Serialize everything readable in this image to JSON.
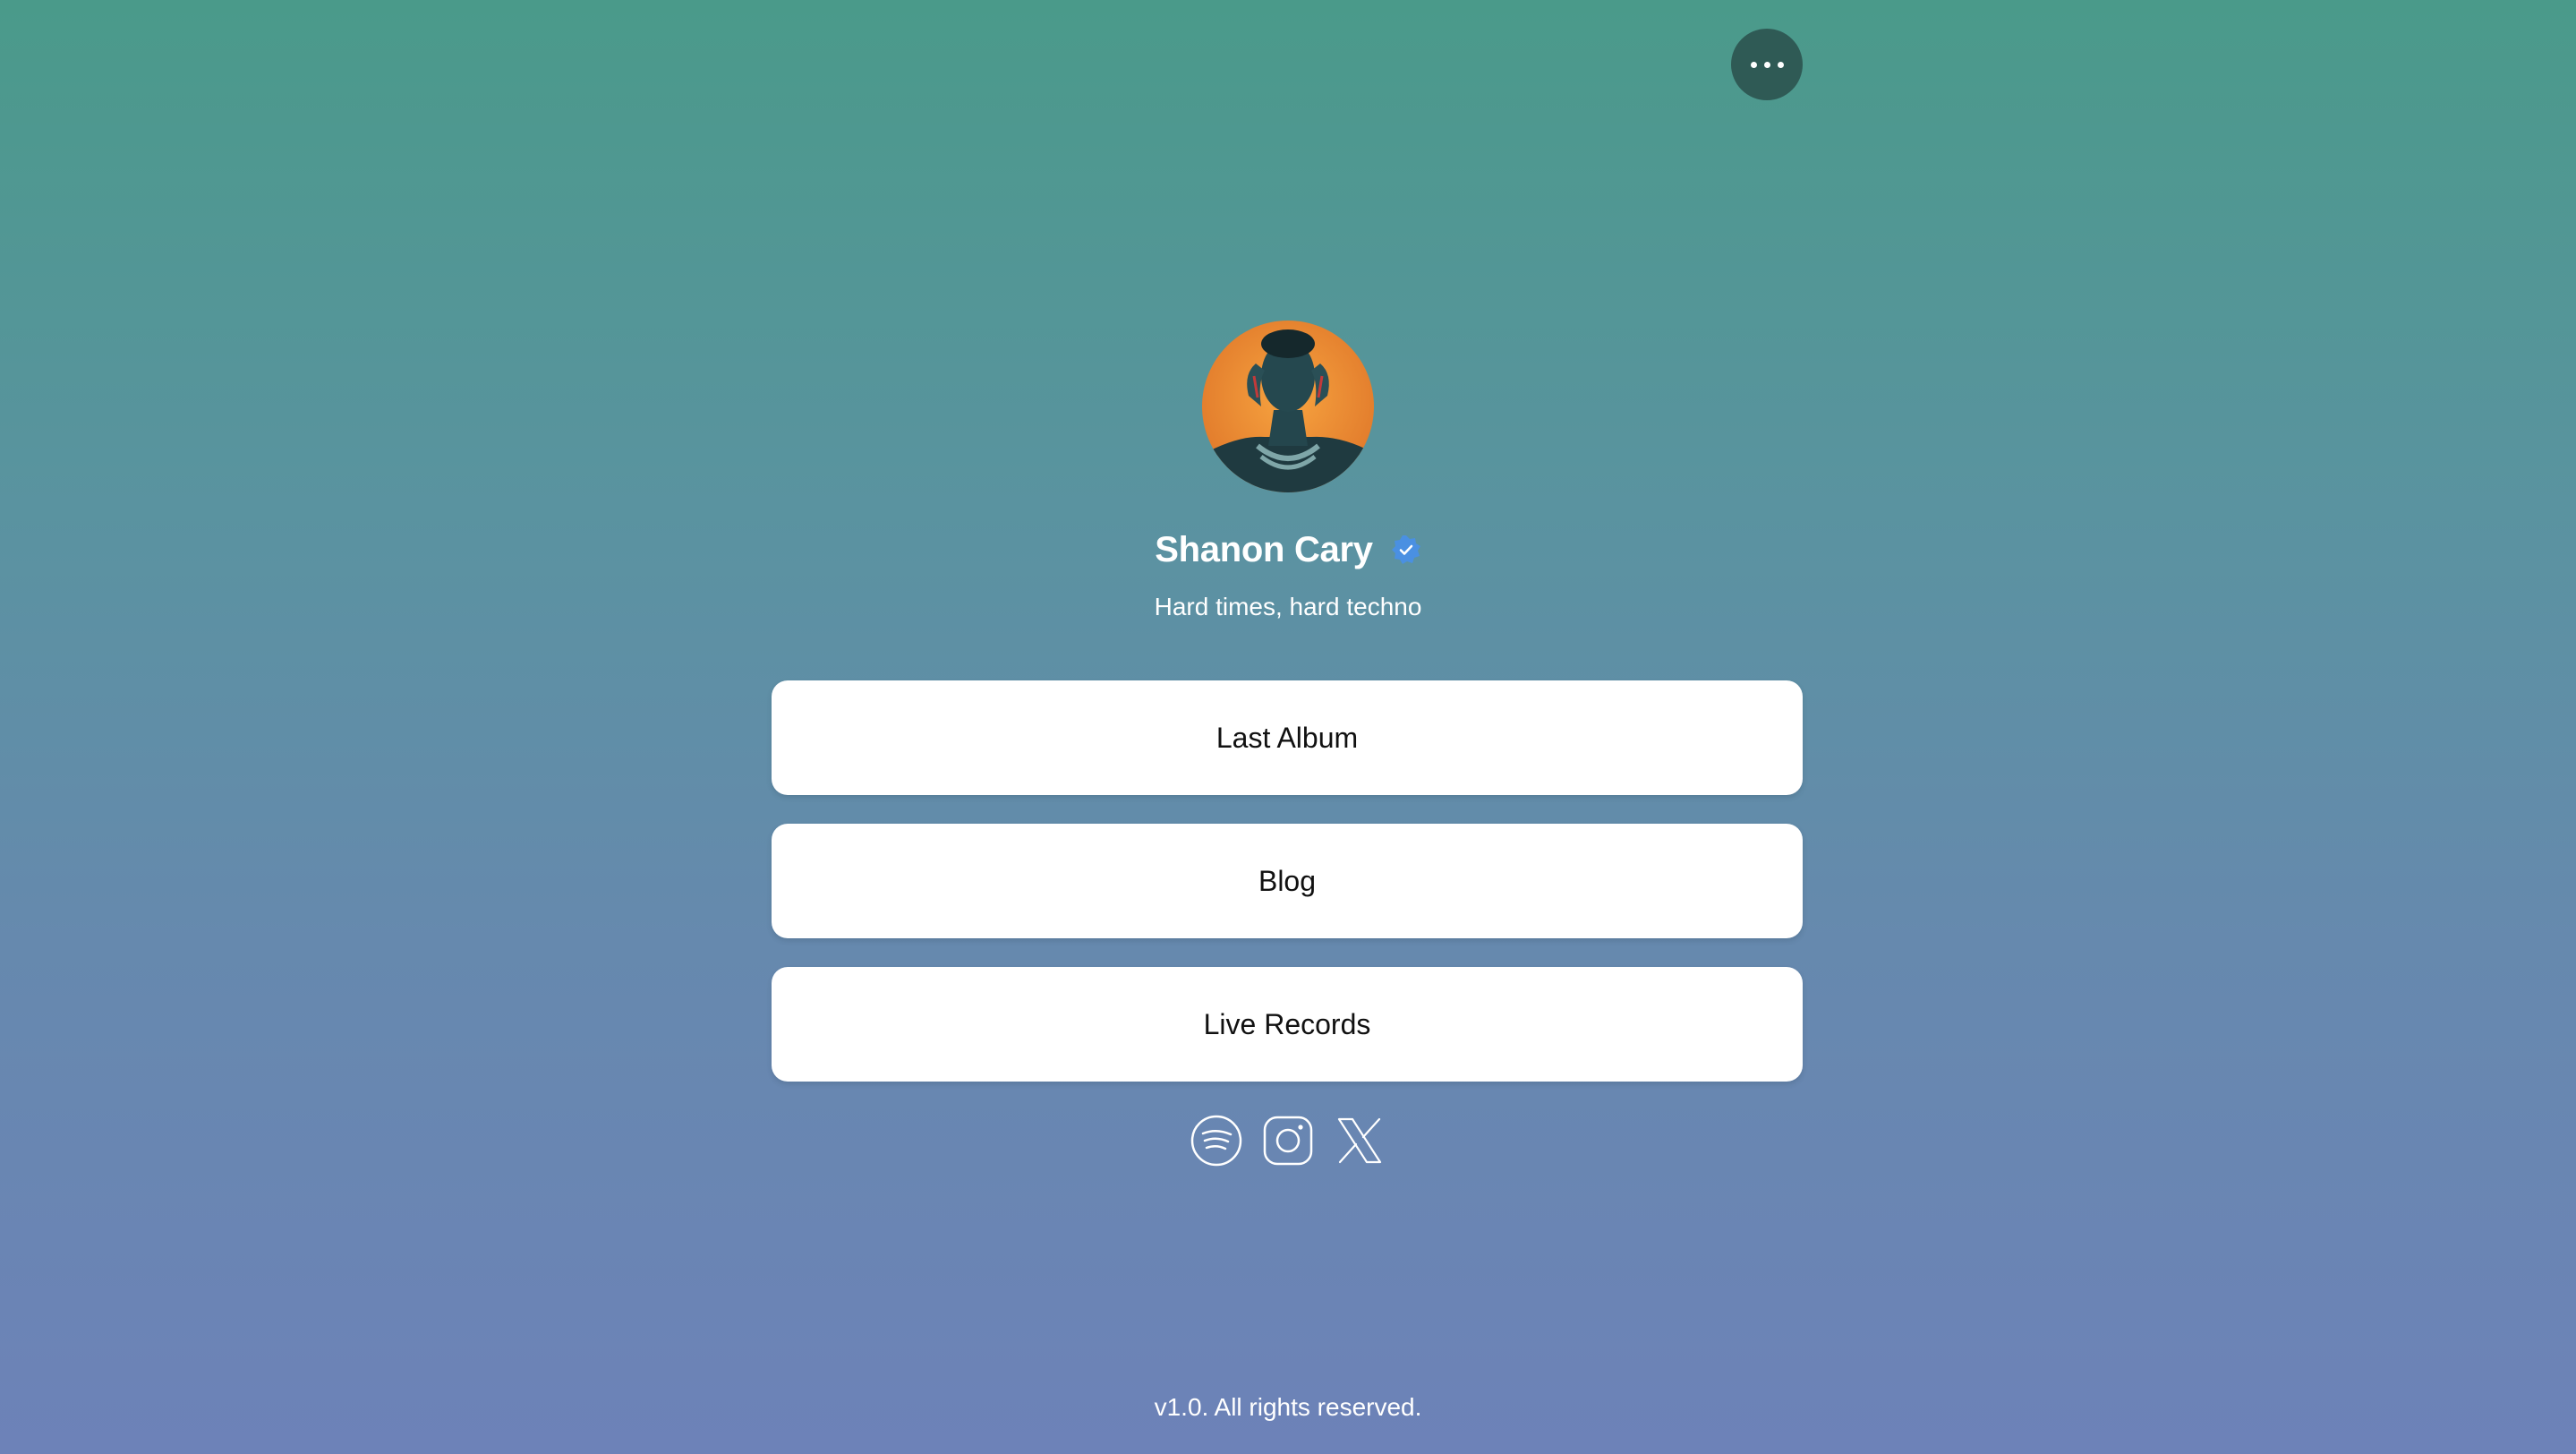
{
  "header": {
    "menu_icon": "more-horizontal-icon"
  },
  "profile": {
    "name": "Shanon Cary",
    "verified_icon": "verified-badge-icon",
    "bio": "Hard times, hard techno",
    "avatar_icon": "profile-photo"
  },
  "links": [
    {
      "label": "Last Album"
    },
    {
      "label": "Blog"
    },
    {
      "label": "Live Records"
    }
  ],
  "socials": [
    {
      "icon": "spotify-icon"
    },
    {
      "icon": "instagram-icon"
    },
    {
      "icon": "x-twitter-icon"
    }
  ],
  "footer": {
    "text": "v1.0. All rights reserved."
  },
  "colors": {
    "background_top": "#4a9a8a",
    "background_bottom": "#6d82b8",
    "menu_button": "#2f5a55",
    "verified_badge": "#4a90e2",
    "card": "#ffffff"
  }
}
